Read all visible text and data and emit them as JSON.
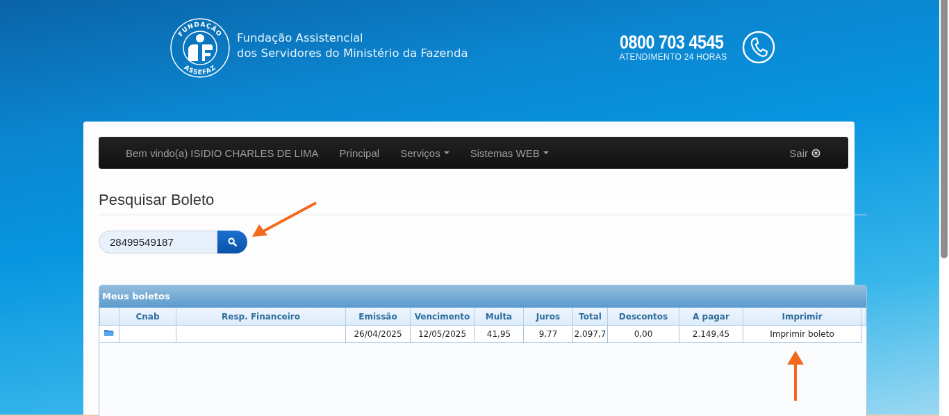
{
  "header": {
    "logo_top": "FUNDAÇÃO",
    "logo_bottom": "ASSEFAZ",
    "org_line_1": "Fundação Assistencial",
    "org_line_2": "dos Servidores do Ministério da Fazenda",
    "phone": "0800 703 4545",
    "phone_caption": "ATENDIMENTO 24 HORAS"
  },
  "navbar": {
    "items": [
      {
        "label": "Bem vindo(a) ISIDIO CHARLES DE LIMA",
        "kind": "text"
      },
      {
        "label": "Principal",
        "kind": "link"
      },
      {
        "label": "Serviços",
        "kind": "dropdown"
      },
      {
        "label": "Sistemas WEB",
        "kind": "dropdown"
      }
    ],
    "logout": "Sair"
  },
  "page_title": "Pesquisar Boleto",
  "search": {
    "value": "28499549187"
  },
  "grid": {
    "title": "Meus boletos",
    "columns": [
      "Cnab",
      "Resp. Financeiro",
      "Emissão",
      "Vencimento",
      "Multa",
      "Juros",
      "Total",
      "Descontos",
      "A pagar",
      "Imprimir"
    ],
    "rows": [
      {
        "cells": [
          "",
          "",
          "26/04/2025",
          "12/05/2025",
          "41,95",
          "9,77",
          "2.097,7",
          "0,00",
          "2.149,45"
        ],
        "print_link": "Imprimir boleto"
      }
    ]
  }
}
